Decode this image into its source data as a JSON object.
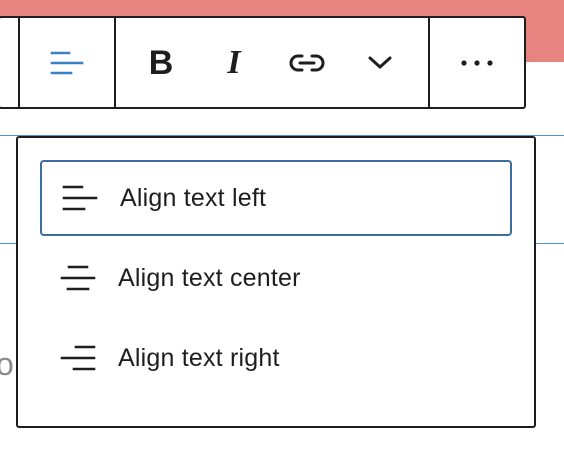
{
  "toolbar": {
    "align_icon": "align-left-icon",
    "align_icon_color": "#3a80c4",
    "bold_label": "B",
    "italic_label": "I",
    "link_icon": "link-icon",
    "more_rich_text_icon": "chevron-down-icon",
    "options_icon": "ellipsis-icon"
  },
  "align_menu": {
    "items": [
      {
        "label": "Align text left",
        "icon": "align-left-icon",
        "active": true
      },
      {
        "label": "Align text center",
        "icon": "align-center-icon",
        "active": false
      },
      {
        "label": "Align text right",
        "icon": "align-right-icon",
        "active": false
      }
    ]
  },
  "colors": {
    "banner": "#e8847f",
    "focus_ring": "#3a6f9f",
    "block_outline": "#4f8fd6",
    "text": "#1e1e1e"
  },
  "background": {
    "partial_glyph": "o"
  }
}
